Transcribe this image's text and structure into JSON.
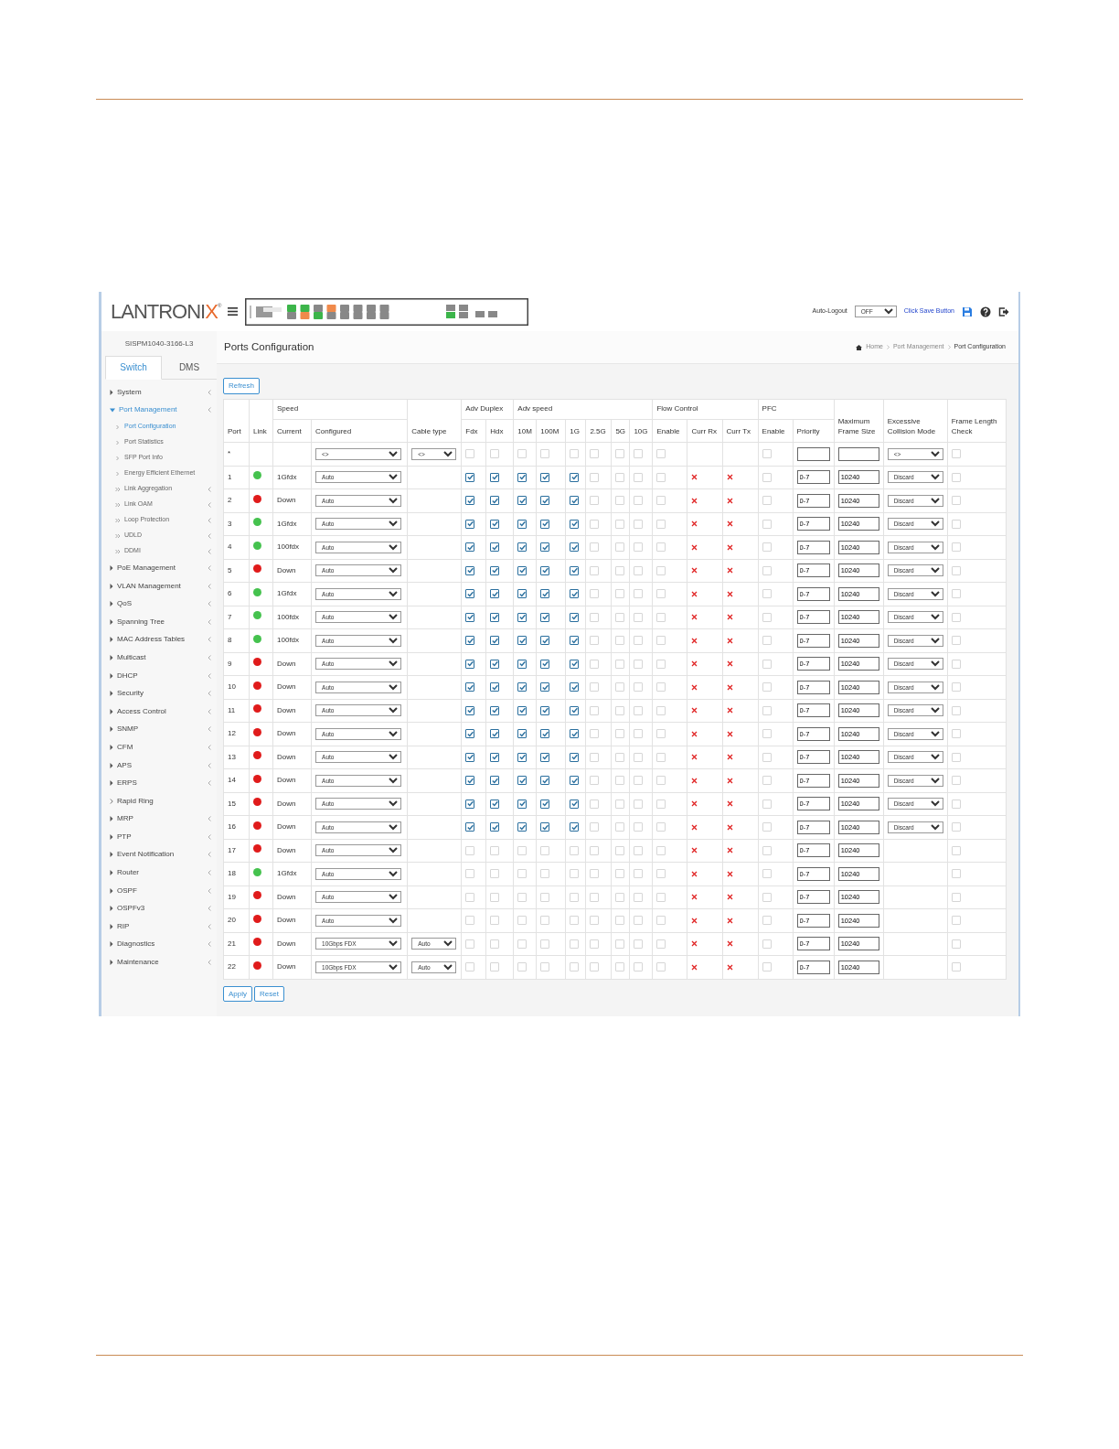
{
  "header": {
    "logo": {
      "text": "LANTRONI",
      "accent": "X",
      "mark": "®"
    },
    "auto_logout_label": "Auto-Logout",
    "auto_logout_value": "OFF",
    "save_link": "Click Save Button"
  },
  "sidebar": {
    "model": "SISPM1040-3166-L3",
    "tabs": [
      {
        "label": "Switch",
        "selected": true
      },
      {
        "label": "DMS",
        "selected": false
      }
    ],
    "items": [
      {
        "label": "System",
        "submenu": true,
        "expanded": false
      },
      {
        "label": "Port Management",
        "submenu": true,
        "expanded": true,
        "children": [
          {
            "label": "Port Configuration",
            "submenu": false,
            "selected": true
          },
          {
            "label": "Port Statistics",
            "submenu": false,
            "selected": false
          },
          {
            "label": "SFP Port Info",
            "submenu": false,
            "selected": false
          },
          {
            "label": "Energy Efficient Ethernet",
            "submenu": false,
            "selected": false
          },
          {
            "label": "Link Aggregation",
            "submenu": true,
            "selected": false
          },
          {
            "label": "Link OAM",
            "submenu": true,
            "selected": false
          },
          {
            "label": "Loop Protection",
            "submenu": true,
            "selected": false
          },
          {
            "label": "UDLD",
            "submenu": true,
            "selected": false
          },
          {
            "label": "DDMI",
            "submenu": true,
            "selected": false
          }
        ]
      },
      {
        "label": "PoE Management",
        "submenu": true,
        "expanded": false
      },
      {
        "label": "VLAN Management",
        "submenu": true,
        "expanded": false
      },
      {
        "label": "QoS",
        "submenu": true,
        "expanded": false
      },
      {
        "label": "Spanning Tree",
        "submenu": true,
        "expanded": false
      },
      {
        "label": "MAC Address Tables",
        "submenu": true,
        "expanded": false
      },
      {
        "label": "Multicast",
        "submenu": true,
        "expanded": false
      },
      {
        "label": "DHCP",
        "submenu": true,
        "expanded": false
      },
      {
        "label": "Security",
        "submenu": true,
        "expanded": false
      },
      {
        "label": "Access Control",
        "submenu": true,
        "expanded": false
      },
      {
        "label": "SNMP",
        "submenu": true,
        "expanded": false
      },
      {
        "label": "CFM",
        "submenu": true,
        "expanded": false
      },
      {
        "label": "APS",
        "submenu": true,
        "expanded": false
      },
      {
        "label": "ERPS",
        "submenu": true,
        "expanded": false
      },
      {
        "label": "Rapid Ring",
        "submenu": false,
        "expanded": false
      },
      {
        "label": "MRP",
        "submenu": true,
        "expanded": false
      },
      {
        "label": "PTP",
        "submenu": true,
        "expanded": false
      },
      {
        "label": "Event Notification",
        "submenu": true,
        "expanded": false
      },
      {
        "label": "Router",
        "submenu": true,
        "expanded": false
      },
      {
        "label": "OSPF",
        "submenu": true,
        "expanded": false
      },
      {
        "label": "OSPFv3",
        "submenu": true,
        "expanded": false
      },
      {
        "label": "RIP",
        "submenu": true,
        "expanded": false
      },
      {
        "label": "Diagnostics",
        "submenu": true,
        "expanded": false
      },
      {
        "label": "Maintenance",
        "submenu": true,
        "expanded": false
      }
    ]
  },
  "page": {
    "title": "Ports Configuration",
    "breadcrumb": [
      "Home",
      "Port Management",
      "Port Configuration"
    ],
    "refresh": "Refresh",
    "apply": "Apply",
    "reset": "Reset"
  },
  "table": {
    "headers": [
      {
        "label": "Port"
      },
      {
        "label": "Link"
      },
      {
        "label": "Speed",
        "columns": [
          "Current",
          "Configured"
        ]
      },
      {
        "label": "Cable type"
      },
      {
        "label": "Adv Duplex",
        "columns": [
          "Fdx",
          "Hdx"
        ]
      },
      {
        "label": "Adv speed",
        "columns": [
          "10M",
          "100M",
          "1G",
          "2.5G",
          "5G",
          "10G"
        ]
      },
      {
        "label": "Flow Control",
        "columns": [
          "Enable",
          "Curr Rx",
          "Curr Tx"
        ]
      },
      {
        "label": "PFC",
        "columns": [
          "Enable",
          "Priority"
        ]
      },
      {
        "label": "Maximum Frame Size"
      },
      {
        "label": "Excessive Collision Mode"
      },
      {
        "label": "Frame Length Check"
      }
    ],
    "all_row": {
      "port": "*",
      "configured": "<>",
      "cable_type": "<>",
      "adv_duplex": [
        false,
        false
      ],
      "adv_speed": [
        false,
        false,
        false,
        false,
        false,
        false
      ],
      "fc_enable": false,
      "pfc_enable": false,
      "collision_mode": "<>",
      "frame_length_check": false
    },
    "rows": [
      {
        "port": "1",
        "link_up": true,
        "current": "1Gfdx",
        "configured": "Auto",
        "adv_duplex": [
          true,
          true
        ],
        "adv_speed": [
          true,
          true,
          true,
          false,
          false,
          false
        ],
        "fc_enable": false,
        "curr_rx": false,
        "curr_tx": false,
        "pfc_enable": false,
        "priority": "0-7",
        "max_frame": "10240",
        "collision_mode": "Discard",
        "frame_length_check": false
      },
      {
        "port": "2",
        "link_up": false,
        "current": "Down",
        "configured": "Auto",
        "adv_duplex": [
          true,
          true
        ],
        "adv_speed": [
          true,
          true,
          true,
          false,
          false,
          false
        ],
        "fc_enable": false,
        "curr_rx": false,
        "curr_tx": false,
        "pfc_enable": false,
        "priority": "0-7",
        "max_frame": "10240",
        "collision_mode": "Discard",
        "frame_length_check": false
      },
      {
        "port": "3",
        "link_up": true,
        "current": "1Gfdx",
        "configured": "Auto",
        "adv_duplex": [
          true,
          true
        ],
        "adv_speed": [
          true,
          true,
          true,
          false,
          false,
          false
        ],
        "fc_enable": false,
        "curr_rx": false,
        "curr_tx": false,
        "pfc_enable": false,
        "priority": "0-7",
        "max_frame": "10240",
        "collision_mode": "Discard",
        "frame_length_check": false
      },
      {
        "port": "4",
        "link_up": true,
        "current": "100fdx",
        "configured": "Auto",
        "adv_duplex": [
          true,
          true
        ],
        "adv_speed": [
          true,
          true,
          true,
          false,
          false,
          false
        ],
        "fc_enable": false,
        "curr_rx": false,
        "curr_tx": false,
        "pfc_enable": false,
        "priority": "0-7",
        "max_frame": "10240",
        "collision_mode": "Discard",
        "frame_length_check": false
      },
      {
        "port": "5",
        "link_up": false,
        "current": "Down",
        "configured": "Auto",
        "adv_duplex": [
          true,
          true
        ],
        "adv_speed": [
          true,
          true,
          true,
          false,
          false,
          false
        ],
        "fc_enable": false,
        "curr_rx": false,
        "curr_tx": false,
        "pfc_enable": false,
        "priority": "0-7",
        "max_frame": "10240",
        "collision_mode": "Discard",
        "frame_length_check": false
      },
      {
        "port": "6",
        "link_up": true,
        "current": "1Gfdx",
        "configured": "Auto",
        "adv_duplex": [
          true,
          true
        ],
        "adv_speed": [
          true,
          true,
          true,
          false,
          false,
          false
        ],
        "fc_enable": false,
        "curr_rx": false,
        "curr_tx": false,
        "pfc_enable": false,
        "priority": "0-7",
        "max_frame": "10240",
        "collision_mode": "Discard",
        "frame_length_check": false
      },
      {
        "port": "7",
        "link_up": true,
        "current": "100fdx",
        "configured": "Auto",
        "adv_duplex": [
          true,
          true
        ],
        "adv_speed": [
          true,
          true,
          true,
          false,
          false,
          false
        ],
        "fc_enable": false,
        "curr_rx": false,
        "curr_tx": false,
        "pfc_enable": false,
        "priority": "0-7",
        "max_frame": "10240",
        "collision_mode": "Discard",
        "frame_length_check": false
      },
      {
        "port": "8",
        "link_up": true,
        "current": "100fdx",
        "configured": "Auto",
        "adv_duplex": [
          true,
          true
        ],
        "adv_speed": [
          true,
          true,
          true,
          false,
          false,
          false
        ],
        "fc_enable": false,
        "curr_rx": false,
        "curr_tx": false,
        "pfc_enable": false,
        "priority": "0-7",
        "max_frame": "10240",
        "collision_mode": "Discard",
        "frame_length_check": false
      },
      {
        "port": "9",
        "link_up": false,
        "current": "Down",
        "configured": "Auto",
        "adv_duplex": [
          true,
          true
        ],
        "adv_speed": [
          true,
          true,
          true,
          false,
          false,
          false
        ],
        "fc_enable": false,
        "curr_rx": false,
        "curr_tx": false,
        "pfc_enable": false,
        "priority": "0-7",
        "max_frame": "10240",
        "collision_mode": "Discard",
        "frame_length_check": false
      },
      {
        "port": "10",
        "link_up": false,
        "current": "Down",
        "configured": "Auto",
        "adv_duplex": [
          true,
          true
        ],
        "adv_speed": [
          true,
          true,
          true,
          false,
          false,
          false
        ],
        "fc_enable": false,
        "curr_rx": false,
        "curr_tx": false,
        "pfc_enable": false,
        "priority": "0-7",
        "max_frame": "10240",
        "collision_mode": "Discard",
        "frame_length_check": false
      },
      {
        "port": "11",
        "link_up": false,
        "current": "Down",
        "configured": "Auto",
        "adv_duplex": [
          true,
          true
        ],
        "adv_speed": [
          true,
          true,
          true,
          false,
          false,
          false
        ],
        "fc_enable": false,
        "curr_rx": false,
        "curr_tx": false,
        "pfc_enable": false,
        "priority": "0-7",
        "max_frame": "10240",
        "collision_mode": "Discard",
        "frame_length_check": false
      },
      {
        "port": "12",
        "link_up": false,
        "current": "Down",
        "configured": "Auto",
        "adv_duplex": [
          true,
          true
        ],
        "adv_speed": [
          true,
          true,
          true,
          false,
          false,
          false
        ],
        "fc_enable": false,
        "curr_rx": false,
        "curr_tx": false,
        "pfc_enable": false,
        "priority": "0-7",
        "max_frame": "10240",
        "collision_mode": "Discard",
        "frame_length_check": false
      },
      {
        "port": "13",
        "link_up": false,
        "current": "Down",
        "configured": "Auto",
        "adv_duplex": [
          true,
          true
        ],
        "adv_speed": [
          true,
          true,
          true,
          false,
          false,
          false
        ],
        "fc_enable": false,
        "curr_rx": false,
        "curr_tx": false,
        "pfc_enable": false,
        "priority": "0-7",
        "max_frame": "10240",
        "collision_mode": "Discard",
        "frame_length_check": false
      },
      {
        "port": "14",
        "link_up": false,
        "current": "Down",
        "configured": "Auto",
        "adv_duplex": [
          true,
          true
        ],
        "adv_speed": [
          true,
          true,
          true,
          false,
          false,
          false
        ],
        "fc_enable": false,
        "curr_rx": false,
        "curr_tx": false,
        "pfc_enable": false,
        "priority": "0-7",
        "max_frame": "10240",
        "collision_mode": "Discard",
        "frame_length_check": false
      },
      {
        "port": "15",
        "link_up": false,
        "current": "Down",
        "configured": "Auto",
        "adv_duplex": [
          true,
          true
        ],
        "adv_speed": [
          true,
          true,
          true,
          false,
          false,
          false
        ],
        "fc_enable": false,
        "curr_rx": false,
        "curr_tx": false,
        "pfc_enable": false,
        "priority": "0-7",
        "max_frame": "10240",
        "collision_mode": "Discard",
        "frame_length_check": false
      },
      {
        "port": "16",
        "link_up": false,
        "current": "Down",
        "configured": "Auto",
        "adv_duplex": [
          true,
          true
        ],
        "adv_speed": [
          true,
          true,
          true,
          false,
          false,
          false
        ],
        "fc_enable": false,
        "curr_rx": false,
        "curr_tx": false,
        "pfc_enable": false,
        "priority": "0-7",
        "max_frame": "10240",
        "collision_mode": "Discard",
        "frame_length_check": false
      },
      {
        "port": "17",
        "link_up": false,
        "current": "Down",
        "configured": "Auto",
        "adv_duplex": [
          false,
          false
        ],
        "adv_speed": [
          false,
          false,
          false,
          false,
          false,
          false
        ],
        "fc_enable": false,
        "curr_rx": false,
        "curr_tx": false,
        "pfc_enable": false,
        "priority": "0-7",
        "max_frame": "10240",
        "frame_length_check": false
      },
      {
        "port": "18",
        "link_up": true,
        "current": "1Gfdx",
        "configured": "Auto",
        "adv_duplex": [
          false,
          false
        ],
        "adv_speed": [
          false,
          false,
          false,
          false,
          false,
          false
        ],
        "fc_enable": false,
        "curr_rx": false,
        "curr_tx": false,
        "pfc_enable": false,
        "priority": "0-7",
        "max_frame": "10240",
        "frame_length_check": false
      },
      {
        "port": "19",
        "link_up": false,
        "current": "Down",
        "configured": "Auto",
        "adv_duplex": [
          false,
          false
        ],
        "adv_speed": [
          false,
          false,
          false,
          false,
          false,
          false
        ],
        "fc_enable": false,
        "curr_rx": false,
        "curr_tx": false,
        "pfc_enable": false,
        "priority": "0-7",
        "max_frame": "10240",
        "frame_length_check": false
      },
      {
        "port": "20",
        "link_up": false,
        "current": "Down",
        "configured": "Auto",
        "adv_duplex": [
          false,
          false
        ],
        "adv_speed": [
          false,
          false,
          false,
          false,
          false,
          false
        ],
        "fc_enable": false,
        "curr_rx": false,
        "curr_tx": false,
        "pfc_enable": false,
        "priority": "0-7",
        "max_frame": "10240",
        "frame_length_check": false
      },
      {
        "port": "21",
        "link_up": false,
        "current": "Down",
        "configured": "10Gbps FDX",
        "cable_type": "Auto",
        "adv_duplex": [
          false,
          false
        ],
        "adv_speed": [
          false,
          false,
          false,
          false,
          false,
          false
        ],
        "fc_enable": false,
        "curr_rx": false,
        "curr_tx": false,
        "pfc_enable": false,
        "priority": "0-7",
        "max_frame": "10240",
        "frame_length_check": false
      },
      {
        "port": "22",
        "link_up": false,
        "current": "Down",
        "configured": "10Gbps FDX",
        "cable_type": "Auto",
        "adv_duplex": [
          false,
          false
        ],
        "adv_speed": [
          false,
          false,
          false,
          false,
          false,
          false
        ],
        "fc_enable": false,
        "curr_rx": false,
        "curr_tx": false,
        "pfc_enable": false,
        "priority": "0-7",
        "max_frame": "10240",
        "frame_length_check": false
      }
    ]
  }
}
